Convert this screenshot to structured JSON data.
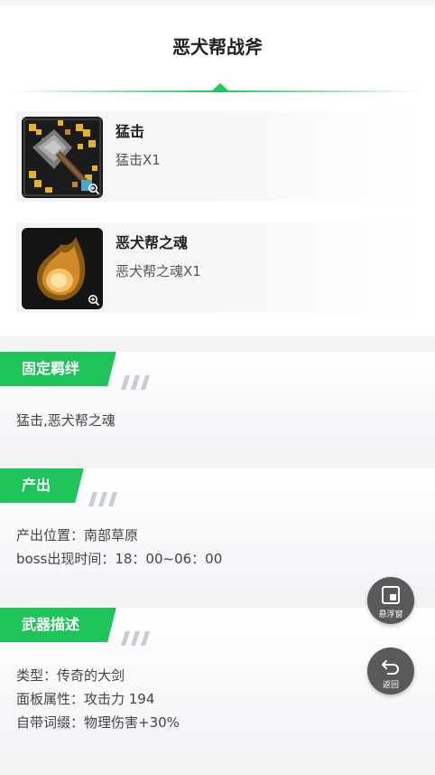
{
  "header": {
    "title": "恶犬帮战斧"
  },
  "materials": [
    {
      "name": "猛击",
      "qty": "猛击X1",
      "icon": "axe-weapon-icon"
    },
    {
      "name": "恶犬帮之魂",
      "qty": "恶犬帮之魂X1",
      "icon": "soul-flame-icon"
    }
  ],
  "bond": {
    "heading": "固定羁绊",
    "text": "猛击,恶犬帮之魂"
  },
  "output": {
    "heading": "产出",
    "line1": "产出位置：南部草原",
    "line2": "boss出现时间：18：00~06：00"
  },
  "weapon": {
    "heading": "武器描述",
    "line1": "类型：传奇的大剑",
    "line2": "面板属性：攻击力 194",
    "line3": "自带词缀：物理伤害+30%"
  },
  "floating": {
    "window_label": "悬浮窗",
    "back_label": "返回"
  },
  "colors": {
    "accent": "#1ec35a",
    "float_button": "#5a5a5a"
  }
}
